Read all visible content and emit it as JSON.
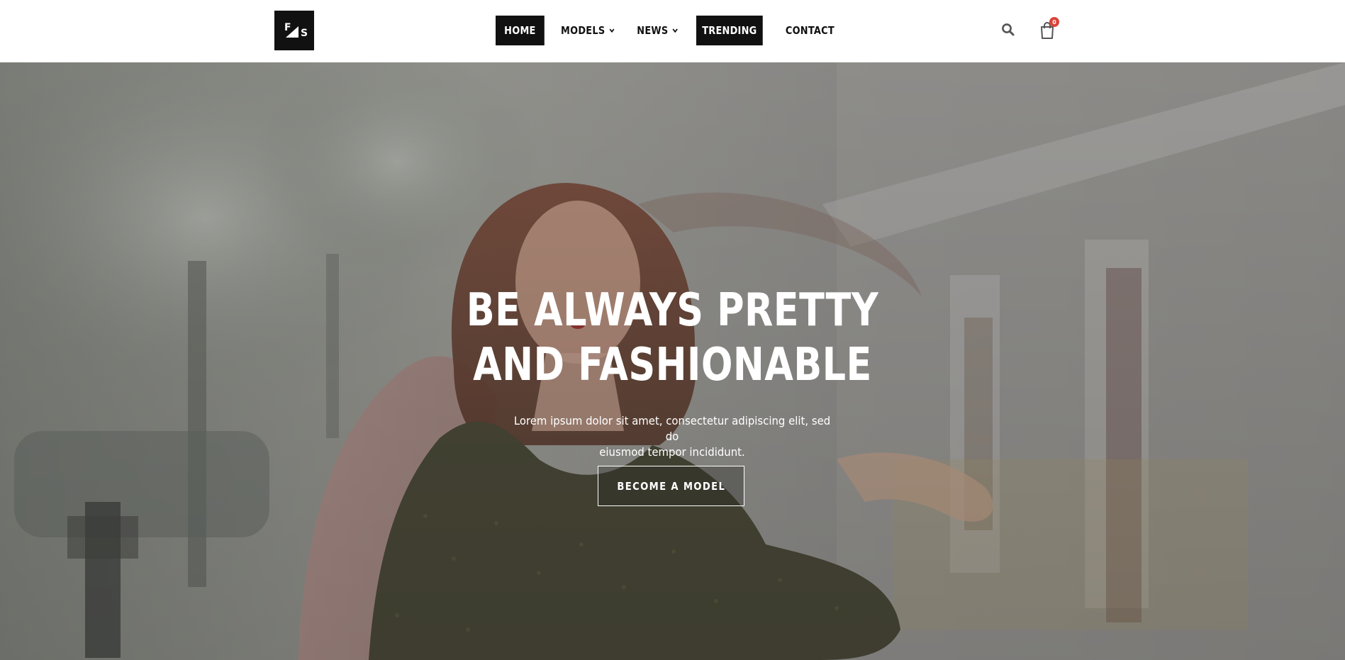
{
  "logo": {
    "letters": [
      "F",
      "S"
    ]
  },
  "nav": {
    "items": [
      {
        "label": "HOME",
        "active": true
      },
      {
        "label": "MODELS",
        "dropdown": true
      },
      {
        "label": "NEWS",
        "dropdown": true
      },
      {
        "label": "TRENDING",
        "active": true
      },
      {
        "label": "CONTACT"
      }
    ]
  },
  "icons": {
    "search": "search-icon",
    "cart": "shopping-bag-icon"
  },
  "cart": {
    "count": "0"
  },
  "hero": {
    "title_line1": "BE ALWAYS PRETTY",
    "title_line2": "AND FASHIONABLE",
    "text_line1": "Lorem ipsum dolor sit amet, consectetur adipiscing elit, sed do",
    "text_line2": "eiusmod tempor incididunt.",
    "cta_label": "BECOME A MODEL"
  },
  "colors": {
    "dark": "#111111",
    "badge": "#d9443b",
    "accent_text": "#ffffff"
  }
}
